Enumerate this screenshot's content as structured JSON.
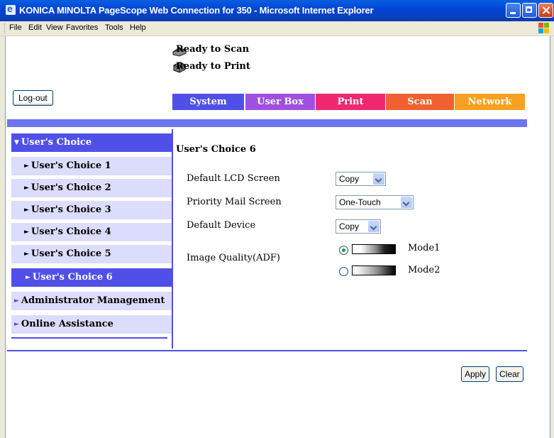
{
  "window": {
    "title": "KONICA MINOLTA PageScope Web Connection for 350 - Microsoft Internet Explorer"
  },
  "menu": [
    "File",
    "Edit",
    "View",
    "Favorites",
    "Tools",
    "Help"
  ],
  "status": {
    "scan": "Ready to Scan",
    "print": "Ready to Print"
  },
  "logout_label": "Log-out",
  "tabs": [
    {
      "label": "System",
      "color": "#5050e8"
    },
    {
      "label": "User Box",
      "color": "#a050e0"
    },
    {
      "label": "Print",
      "color": "#f02870"
    },
    {
      "label": "Scan",
      "color": "#f06030"
    },
    {
      "label": "Network",
      "color": "#f8a020"
    }
  ],
  "sidebar": {
    "header": "User's Choice",
    "items": [
      "User's Choice 1",
      "User's Choice 2",
      "User's Choice 3",
      "User's Choice 4",
      "User's Choice 5",
      "User's Choice 6"
    ],
    "active_index": 5,
    "admin": "Administrator Management",
    "online": "Online Assistance"
  },
  "content": {
    "title": "User's Choice 6",
    "fields": [
      {
        "label": "Default LCD Screen",
        "value": "Copy"
      },
      {
        "label": "Priority Mail Screen",
        "value": "One-Touch"
      },
      {
        "label": "Default Device",
        "value": "Copy"
      }
    ],
    "image_quality": {
      "label": "Image Quality(ADF)",
      "options": [
        {
          "label": "Mode1",
          "selected": true
        },
        {
          "label": "Mode2",
          "selected": false
        }
      ]
    }
  },
  "buttons": {
    "apply": "Apply",
    "clear": "Clear"
  }
}
